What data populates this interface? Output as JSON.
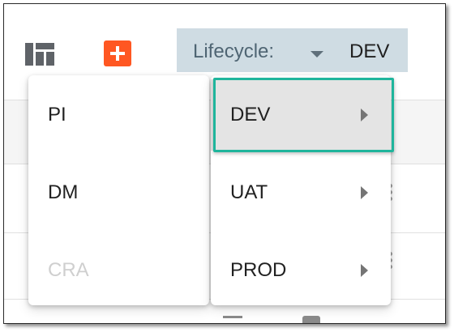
{
  "toolbar": {
    "dashboard_icon": "dashboard-grid-icon",
    "add_icon": "plus-icon",
    "lifecycle_label": "Lifecycle:",
    "lifecycle_value": "DEV",
    "caret_icon": "caret-down-icon"
  },
  "menus": {
    "left": [
      {
        "label": "PI",
        "disabled": false
      },
      {
        "label": "DM",
        "disabled": false
      },
      {
        "label": "CRA",
        "disabled": true
      }
    ],
    "right": [
      {
        "label": "DEV",
        "selected": true,
        "icon": "chevron-right-icon"
      },
      {
        "label": "UAT",
        "selected": false,
        "icon": "chevron-right-icon"
      },
      {
        "label": "PROD",
        "selected": false,
        "icon": "chevron-right-icon"
      }
    ]
  },
  "colors": {
    "accent_add": "#ff5722",
    "lifecycle_bg": "#cfdce3",
    "highlight_border": "#1fb59c",
    "disabled_text": "#cfcfcf"
  }
}
